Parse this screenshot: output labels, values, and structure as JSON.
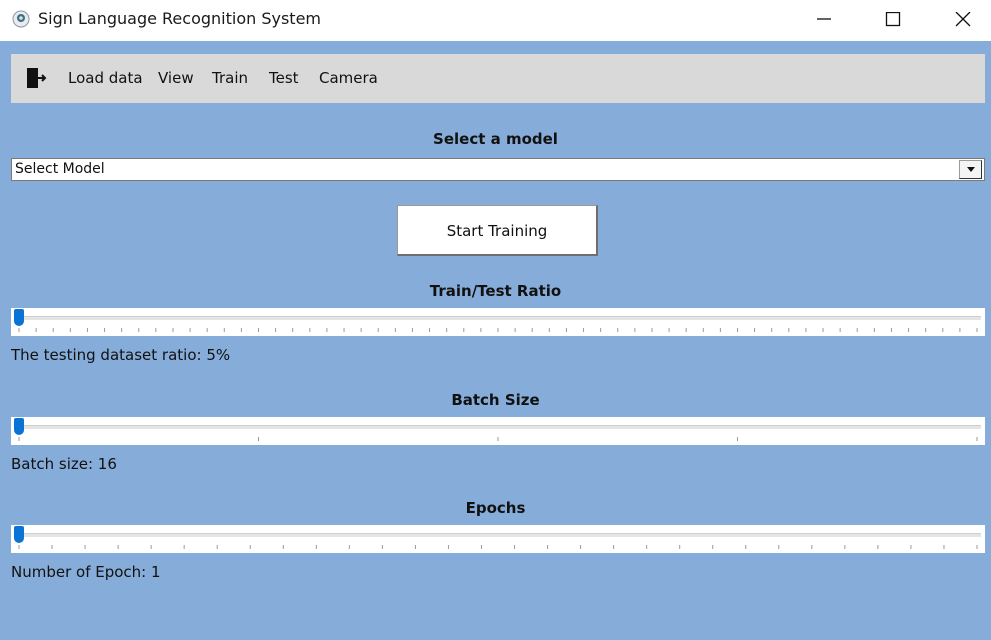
{
  "window": {
    "title": "Sign Language Recognition System",
    "icon": "app-logo-icon"
  },
  "menu": {
    "exit_icon": "exit-door-icon",
    "items": [
      "Load data",
      "View",
      "Train",
      "Test",
      "Camera"
    ]
  },
  "model_select": {
    "title": "Select a model",
    "value": "Select Model"
  },
  "start_button": {
    "label": "Start Training"
  },
  "ratio_slider": {
    "title": "Train/Test Ratio",
    "label": "The testing dataset ratio: 5%",
    "value": 5
  },
  "batch_slider": {
    "title": "Batch Size",
    "label": "Batch size: 16",
    "value": 16
  },
  "epoch_slider": {
    "title": "Epochs",
    "label": "Number of Epoch: 1",
    "value": 1
  },
  "colors": {
    "background": "#86add9",
    "menubar": "#d9d9d9",
    "slider_thumb": "#0a74d6"
  }
}
